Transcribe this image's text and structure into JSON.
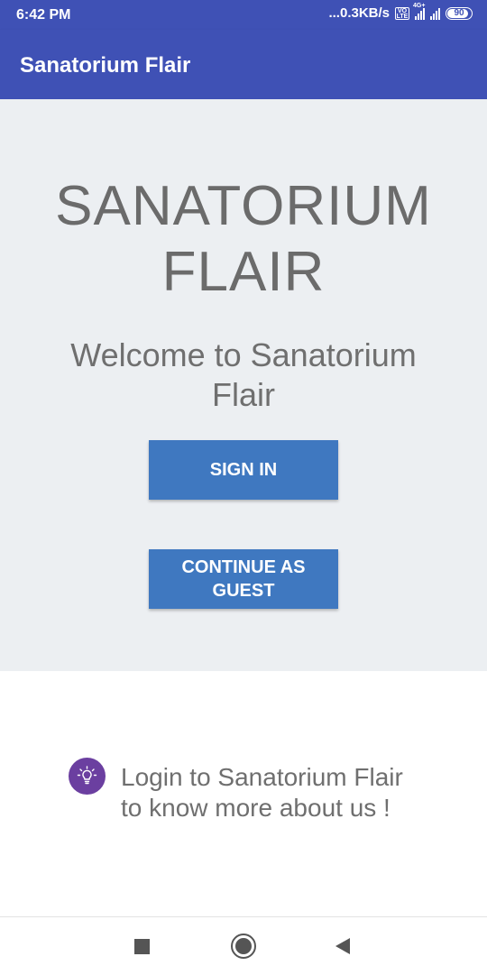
{
  "status_bar": {
    "time": "6:42 PM",
    "net_speed": "...0.3KB/s",
    "volte": "VO LTE",
    "network": "4G+",
    "battery": "90",
    "battery_level": 0.9
  },
  "app_bar": {
    "title": "Sanatorium Flair"
  },
  "hero": {
    "title_line1": "SANATORIUM",
    "title_line2": "FLAIR",
    "welcome": "Welcome to Sanatorium Flair",
    "sign_in_label": "SIGN IN",
    "guest_label": "CONTINUE AS GUEST"
  },
  "tip": {
    "icon": "lightbulb-icon",
    "line1": "Login to Sanatorium Flair",
    "line2": "to know more about us !"
  },
  "nav_bar": {
    "recents_icon": "square-recents-icon",
    "home_icon": "circle-home-icon",
    "back_icon": "triangle-back-icon"
  },
  "colors": {
    "primary": "#3f51b5",
    "button": "#3f78c0",
    "tip_icon_bg": "#6b3fa0",
    "hero_bg": "#eceff2"
  }
}
